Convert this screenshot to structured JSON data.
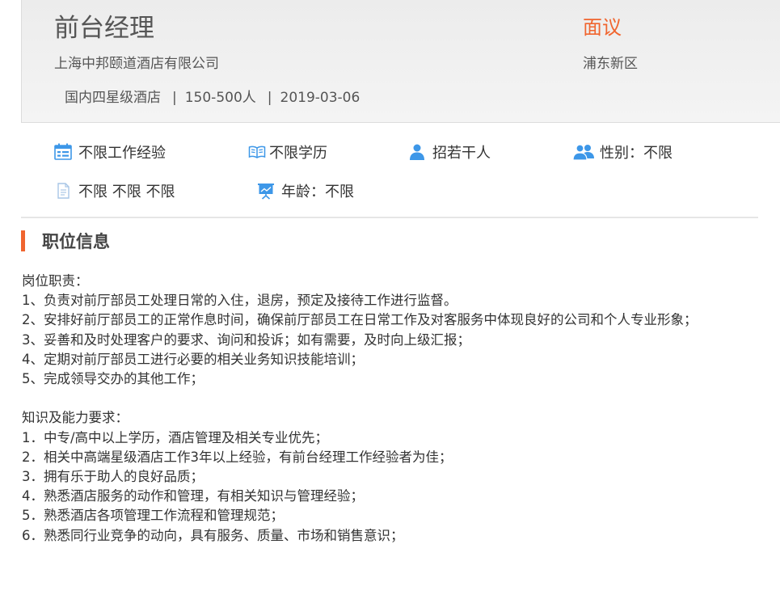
{
  "job": {
    "title": "前台经理",
    "company": "上海中邦颐道酒店有限公司",
    "meta": [
      "国内四星级酒店",
      "150-500人",
      "2019-03-06"
    ],
    "meta_separator": "|",
    "salary": "面议",
    "district": "浦东新区"
  },
  "requirements": [
    {
      "icon": "calendar-icon",
      "text": "不限工作经验"
    },
    {
      "icon": "book-icon",
      "text": "不限学历"
    },
    {
      "icon": "person-icon",
      "text": "招若干人"
    },
    {
      "icon": "people-icon",
      "text": "性别：不限"
    },
    {
      "icon": "document-icon",
      "text": "不限 不限 不限"
    },
    {
      "icon": "presentation-icon",
      "text": "年龄：不限"
    }
  ],
  "section": {
    "title": "职位信息"
  },
  "description": {
    "duties_heading": "岗位职责：",
    "duties": [
      "1、负责对前厅部员工处理日常的入住，退房，预定及接待工作进行监督。",
      "2、安排好前厅部员工的正常作息时间，确保前厅部员工在日常工作及对客服务中体现良好的公司和个人专业形象；",
      "3、妥善和及时处理客户的要求、询问和投诉；如有需要，及时向上级汇报；",
      "4、定期对前厅部员工进行必要的相关业务知识技能培训；",
      "5、完成领导交办的其他工作；"
    ],
    "skills_heading": "知识及能力要求：",
    "skills": [
      "1．中专/高中以上学历，酒店管理及相关专业优先；",
      "2．相关中高端星级酒店工作3年以上经验，有前台经理工作经验者为佳；",
      "3．拥有乐于助人的良好品质；",
      "4．熟悉酒店服务的动作和管理，有相关知识与管理经验；",
      "5．熟悉酒店各项管理工作流程和管理规范；",
      "6．熟悉同行业竞争的动向，具有服务、质量、市场和销售意识；"
    ]
  },
  "colors": {
    "accent": "#f0652f",
    "icon_blue": "#3d97e8"
  }
}
